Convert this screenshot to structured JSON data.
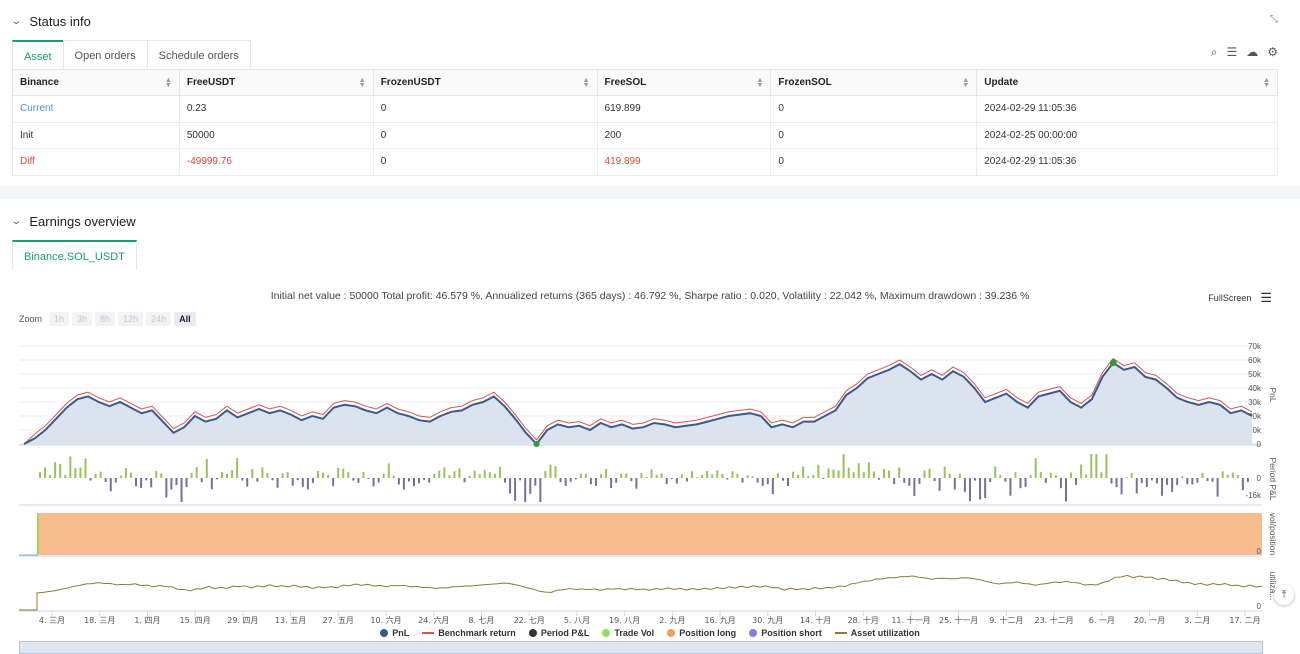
{
  "status": {
    "title": "Status info",
    "tabs": [
      "Asset",
      "Open orders",
      "Schedule orders"
    ],
    "columns": [
      "Binance",
      "FreeUSDT",
      "FrozenUSDT",
      "FreeSOL",
      "FrozenSOL",
      "Update"
    ],
    "rows": [
      {
        "label": "Current",
        "cells": [
          "0.23",
          "0",
          "619.899",
          "0",
          "2024-02-29 11:05:36"
        ]
      },
      {
        "label": "Init",
        "cells": [
          "50000",
          "0",
          "200",
          "0",
          "2024-02-25 00:00:00"
        ]
      },
      {
        "label": "Diff",
        "cells": [
          "-49999.76",
          "0",
          "419.899",
          "0",
          "2024-02-29 11:05:36"
        ]
      }
    ],
    "row_colors": {
      "current": "#4a90d9",
      "diff": "#e8443a"
    }
  },
  "earnings": {
    "title": "Earnings overview",
    "tab": "Binance.SOL_USDT",
    "summary": "Initial net value : 50000 Total profit: 46.579 %, Annualized returns (365 days) : 46.792 %, Sharpe ratio : 0.020, Volatility : 22.042 %, Maximum drawdown : 39.236 %",
    "fullscreen_label": "FullScreen",
    "zoom_label": "Zoom",
    "zoom_options": [
      "1h",
      "3h",
      "8h",
      "12h",
      "24h",
      "All"
    ],
    "zoom_selected": "All"
  },
  "chart_data": {
    "type": "line",
    "panes": [
      "PnL",
      "Period P&L",
      "vol/position",
      "utiliza..."
    ],
    "pnl_ticks": [
      "70k",
      "60k",
      "50k",
      "40k",
      "30k",
      "20k",
      "10k",
      "0"
    ],
    "pnl_tick_values": [
      70000,
      60000,
      50000,
      40000,
      30000,
      20000,
      10000,
      0
    ],
    "period_ticks": [
      "0",
      "-16k"
    ],
    "vol_ticks": [
      "0"
    ],
    "util_ticks": [
      "0"
    ],
    "ylim": [
      0,
      70000
    ],
    "x_ticks": [
      "4. 三月",
      "18. 三月",
      "1. 四月",
      "15. 四月",
      "29. 四月",
      "13. 五月",
      "27. 五月",
      "10. 六月",
      "24. 六月",
      "8. 七月",
      "22. 七月",
      "5. 八月",
      "19. 八月",
      "2. 九月",
      "16. 九月",
      "30. 九月",
      "14. 十月",
      "28. 十月",
      "11. 十一月",
      "25. 十一月",
      "9. 十二月",
      "23. 十二月",
      "6. 一月",
      "20. 一月",
      "3. 二月",
      "17. 二月"
    ],
    "series": [
      {
        "name": "PnL",
        "color": "#3d5a8c",
        "values": [
          0,
          4000,
          10000,
          18000,
          26000,
          32000,
          34000,
          30000,
          27000,
          30000,
          26000,
          22000,
          24000,
          16000,
          8000,
          12000,
          20000,
          16000,
          18000,
          24000,
          19000,
          22000,
          25000,
          22000,
          24000,
          21000,
          17000,
          20000,
          18000,
          26000,
          28000,
          27000,
          24000,
          22000,
          26000,
          22000,
          20000,
          17000,
          16000,
          20000,
          23000,
          24000,
          28000,
          30000,
          34000,
          27000,
          18000,
          8000,
          0,
          10000,
          14000,
          12000,
          13000,
          10000,
          15000,
          12000,
          14000,
          11000,
          12000,
          15000,
          14000,
          12000,
          13000,
          14000,
          16000,
          18000,
          20000,
          21000,
          22000,
          20000,
          12000,
          14000,
          12000,
          16000,
          16000,
          20000,
          24000,
          35000,
          40000,
          47000,
          50000,
          53000,
          57000,
          52000,
          46000,
          50000,
          46000,
          52000,
          48000,
          40000,
          30000,
          33000,
          36000,
          30000,
          26000,
          34000,
          36000,
          38000,
          30000,
          26000,
          32000,
          48000,
          58000,
          53000,
          55000,
          48000,
          46000,
          40000,
          33000,
          30000,
          28000,
          30000,
          28000,
          22000,
          24000,
          20000
        ]
      },
      {
        "name": "Benchmark return",
        "color": "#d9534f",
        "values": [
          0,
          7000,
          13000,
          21000,
          29000,
          35000,
          37000,
          33000,
          30000,
          33000,
          29000,
          25000,
          27000,
          19000,
          11000,
          15000,
          23000,
          19000,
          21000,
          27000,
          22000,
          25000,
          28000,
          25000,
          27000,
          24000,
          20000,
          23000,
          21000,
          29000,
          31000,
          30000,
          27000,
          25000,
          29000,
          25000,
          23000,
          20000,
          19000,
          23000,
          26000,
          27000,
          31000,
          33000,
          37000,
          30000,
          21000,
          11000,
          3000,
          13000,
          17000,
          15000,
          16000,
          13000,
          18000,
          15000,
          17000,
          14000,
          15000,
          18000,
          17000,
          15000,
          16000,
          17000,
          19000,
          21000,
          23000,
          24000,
          25000,
          23000,
          15000,
          17000,
          15000,
          19000,
          19000,
          23000,
          27000,
          38000,
          43000,
          50000,
          53000,
          56000,
          60000,
          55000,
          49000,
          53000,
          49000,
          55000,
          51000,
          43000,
          33000,
          36000,
          39000,
          33000,
          29000,
          37000,
          39000,
          41000,
          33000,
          29000,
          35000,
          51000,
          61000,
          56000,
          58000,
          51000,
          49000,
          43000,
          36000,
          33000,
          31000,
          33000,
          31000,
          25000,
          27000,
          23000
        ]
      }
    ],
    "legend": [
      {
        "name": "PnL",
        "color": "#3d5a8c",
        "shape": "dot"
      },
      {
        "name": "Benchmark return",
        "color": "#d9534f",
        "shape": "line"
      },
      {
        "name": "Period P&L",
        "color": "#333333",
        "shape": "dot"
      },
      {
        "name": "Trade Vol",
        "color": "#90e060",
        "shape": "dot"
      },
      {
        "name": "Position long",
        "color": "#f5a05a",
        "shape": "dot"
      },
      {
        "name": "Position short",
        "color": "#8080e0",
        "shape": "dot"
      },
      {
        "name": "Asset utilization",
        "color": "#8b7a3a",
        "shape": "line"
      }
    ],
    "grid": true,
    "colors": {
      "pnl_fill": "#dbe3ee",
      "position_long": "#f7bd8c",
      "positive_bar": "#9bc15a",
      "negative_bar": "#7a6ea0",
      "utilization": "#8b7a3a"
    }
  }
}
